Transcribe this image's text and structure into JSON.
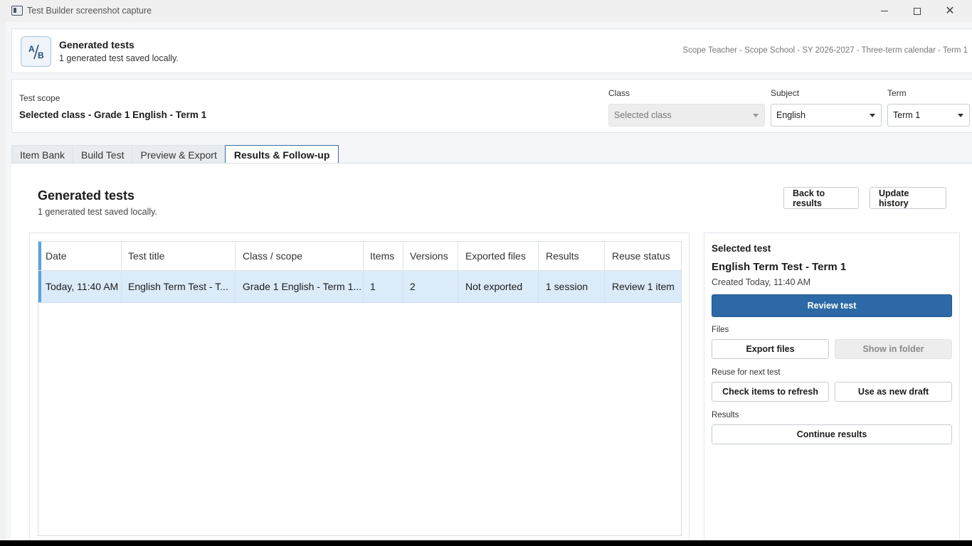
{
  "window": {
    "title": "Test Builder screenshot capture"
  },
  "header": {
    "logo_text": "A/B",
    "title": "Generated tests",
    "subtitle": "1 generated test saved locally.",
    "context": "Scope Teacher - Scope School - SY 2026-2027 - Three-term calendar - Term 1"
  },
  "scope": {
    "label": "Test scope",
    "value": "Selected class - Grade 1 English - Term 1",
    "class_label": "Class",
    "class_value": "Selected class",
    "subject_label": "Subject",
    "subject_value": "English",
    "term_label": "Term",
    "term_value": "Term 1"
  },
  "tabs": [
    {
      "label": "Item Bank",
      "active": false
    },
    {
      "label": "Build Test",
      "active": false
    },
    {
      "label": "Preview & Export",
      "active": false
    },
    {
      "label": "Results & Follow-up",
      "active": true
    }
  ],
  "main": {
    "title": "Generated tests",
    "subtitle": "1 generated test saved locally.",
    "back_button": "Back to results",
    "update_button": "Update history"
  },
  "table": {
    "columns": [
      "Date",
      "Test title",
      "Class / scope",
      "Items",
      "Versions",
      "Exported files",
      "Results",
      "Reuse status"
    ],
    "rows": [
      {
        "date": "Today, 11:40 AM",
        "title": "English Term Test - T...",
        "class_scope": "Grade 1 English - Term 1...",
        "items": "1",
        "versions": "2",
        "exported": "Not exported",
        "results": "1 session",
        "reuse": "Review 1 item"
      }
    ]
  },
  "side": {
    "heading": "Selected test",
    "test_title": "English Term Test - Term 1",
    "created": "Created Today, 11:40 AM",
    "review_button": "Review test",
    "files_label": "Files",
    "export_button": "Export files",
    "show_folder_button": "Show in folder",
    "reuse_label": "Reuse for next test",
    "check_button": "Check items to refresh",
    "draft_button": "Use as new draft",
    "results_label": "Results",
    "continue_button": "Continue results"
  },
  "colors": {
    "accent": "#2c69a6",
    "selection": "#dcebfa",
    "row_marker": "#5aa0e0"
  }
}
